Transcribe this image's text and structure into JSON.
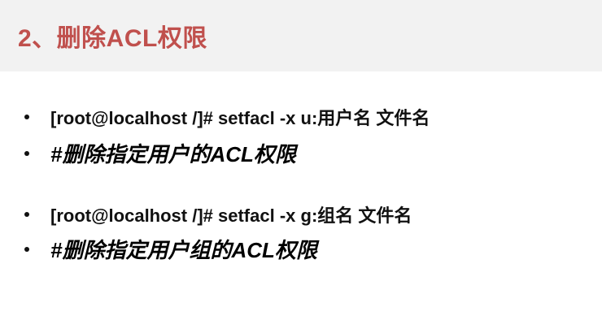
{
  "slide": {
    "title": "2、删除ACL权限",
    "items": [
      {
        "kind": "command",
        "text": "[root@localhost /]# setfacl -x u:用户名 文件名"
      },
      {
        "kind": "comment",
        "text": "#删除指定用户的ACL权限"
      },
      {
        "kind": "command",
        "text": "[root@localhost /]# setfacl -x g:组名 文件名"
      },
      {
        "kind": "comment",
        "text": "#删除指定用户组的ACL权限"
      }
    ],
    "colors": {
      "title": "#c0504d",
      "title_band": "#f2f2f2",
      "text": "#111111",
      "background": "#ffffff"
    }
  }
}
